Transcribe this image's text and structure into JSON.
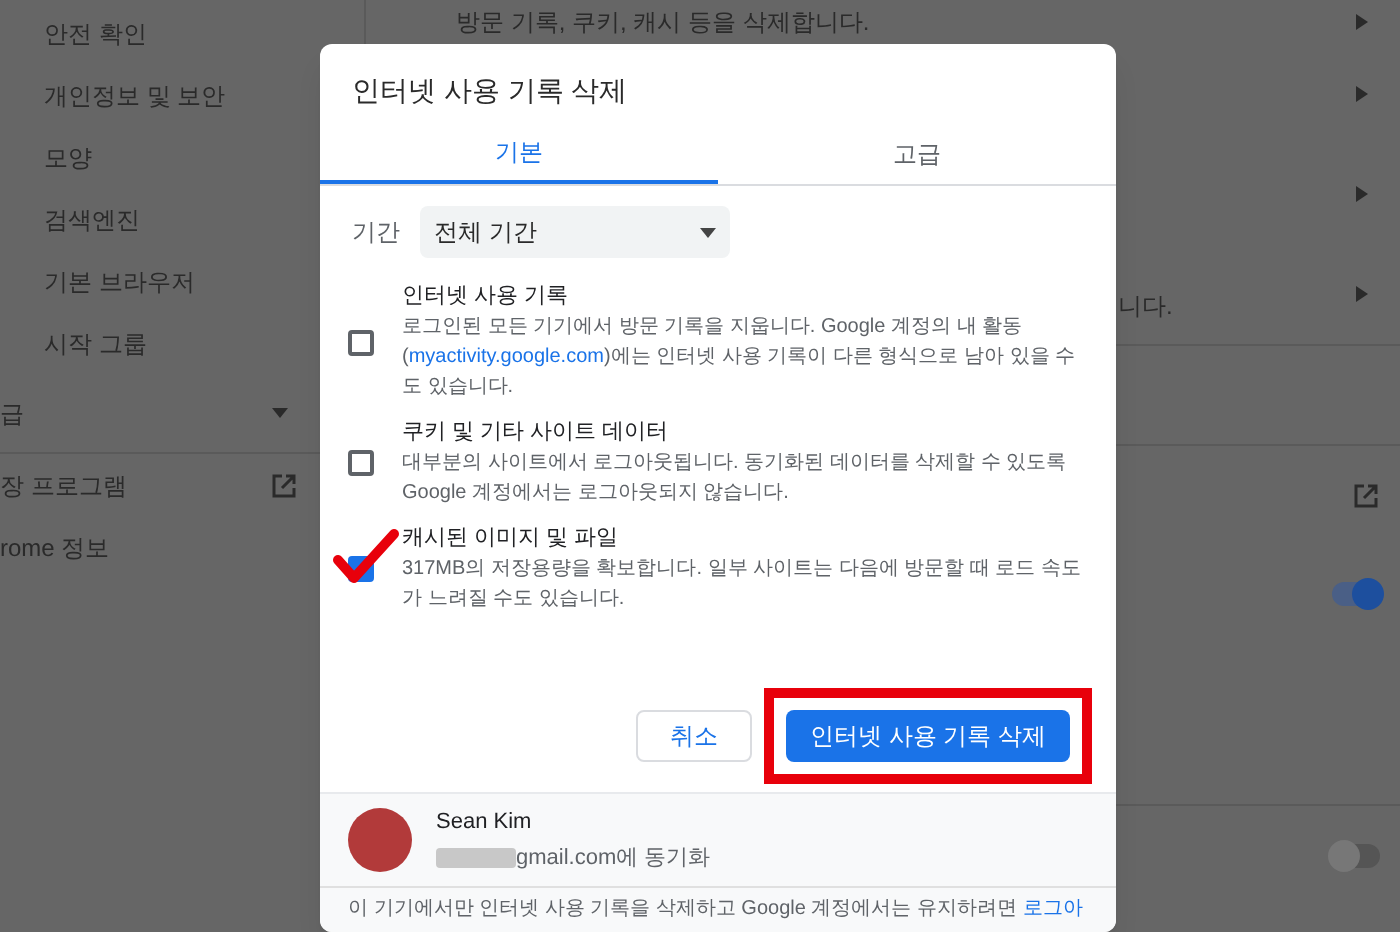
{
  "sidebar": {
    "items": [
      {
        "label": "안전 확인"
      },
      {
        "label": "개인정보 및 보안"
      },
      {
        "label": "모양"
      },
      {
        "label": "검색엔진"
      },
      {
        "label": "기본 브라우저"
      },
      {
        "label": "시작 그룹"
      }
    ],
    "advanced": {
      "label": "급"
    },
    "lower_items": [
      {
        "label": "장 프로그램",
        "external": true
      },
      {
        "label": "rome 정보",
        "external": false
      }
    ]
  },
  "background": {
    "top_text": "방문 기록, 쿠키, 캐시 등을 삭제합니다.",
    "side_text": "니다.",
    "toggles": [
      {
        "on": true
      },
      {
        "on": false
      }
    ]
  },
  "dialog": {
    "title": "인터넷 사용 기록 삭제",
    "tabs": [
      {
        "label": "기본",
        "selected": true
      },
      {
        "label": "고급",
        "selected": false
      }
    ],
    "period": {
      "label": "기간",
      "value": "전체 기간"
    },
    "options": [
      {
        "title": "인터넷 사용 기록",
        "description": "로그인된 모든 기기에서 방문 기록을 지웁니다. Google 계정의 내 활동 (",
        "link": "myactivity.google.com",
        "description_after": ")에는 인터넷 사용 기록이 다른 형식으로 남아 있을 수도 있습니다.",
        "checked": false
      },
      {
        "title": "쿠키 및 기타 사이트 데이터",
        "description": "대부분의 사이트에서 로그아웃됩니다. 동기화된 데이터를 삭제할 수 있도록 Google 계정에서는 로그아웃되지 않습니다.",
        "checked": false
      },
      {
        "title": "캐시된 이미지 및 파일",
        "description": "317MB의 저장용량을 확보합니다. 일부 사이트는 다음에 방문할 때 로드 속도가 느려질 수도 있습니다.",
        "checked": true
      }
    ],
    "buttons": {
      "cancel": "취소",
      "confirm": "인터넷 사용 기록 삭제"
    },
    "account": {
      "name": "Sean Kim",
      "sync": "gmail.com에 동기화"
    },
    "footer": {
      "text": "이 기기에서만 인터넷 사용 기록을 삭제하고 Google 계정에서는 유지하려면",
      "link": "로그아"
    }
  }
}
